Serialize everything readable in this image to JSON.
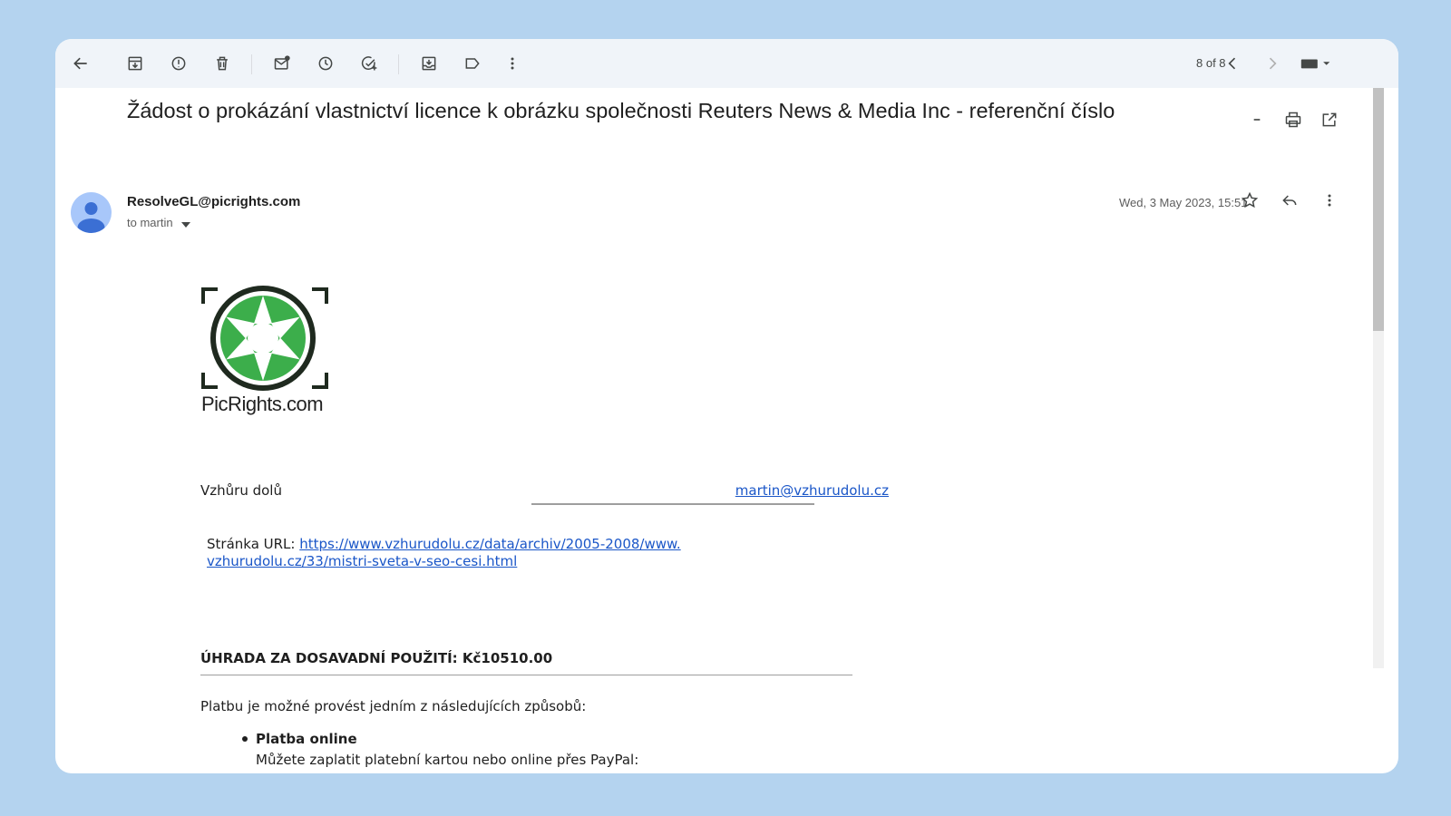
{
  "toolbar": {
    "pager": "8 of 8",
    "icons": [
      "back-arrow-icon",
      "archive-icon",
      "report-spam-icon",
      "delete-icon",
      "mark-unread-icon",
      "snooze-icon",
      "add-task-icon",
      "move-to-icon",
      "label-icon",
      "more-vert-icon",
      "chevron-left-icon",
      "chevron-right-icon",
      "keyboard-icon"
    ]
  },
  "message": {
    "subject": "Žádost o prokázání vlastnictví licence k obrázku společnosti Reuters News & Media Inc - referenční číslo",
    "sender": "ResolveGL@picrights.com",
    "to_line": "to martin",
    "date": "Wed, 3 May 2023, 15:51"
  },
  "body": {
    "logo_text": "PicRights.com",
    "company": "Vzhůru dolů",
    "email": "martin@vzhurudolu.cz",
    "url_label": "Stránka URL: ",
    "url_line1": "https://www.vzhurudolu.cz/data/archiv/2005-2008/www.",
    "url_line2": "vzhurudolu.cz/33/mistri-sveta-v-seo-cesi.html",
    "payment_heading": "ÚHRADA ZA DOSAVADNÍ POUŽITÍ: Kč10510.00",
    "payment_intro": "Platbu je možné provést jedním z následujících způsobů:",
    "online_title": "Platba online",
    "online_desc": "Můžete zaplatit platební kartou nebo online přes PayPal:"
  },
  "colors": {
    "background": "#b4d3ef",
    "toolbar": "#f0f4f9",
    "link": "#1a56c8",
    "logo_green": "#3cae4b"
  }
}
